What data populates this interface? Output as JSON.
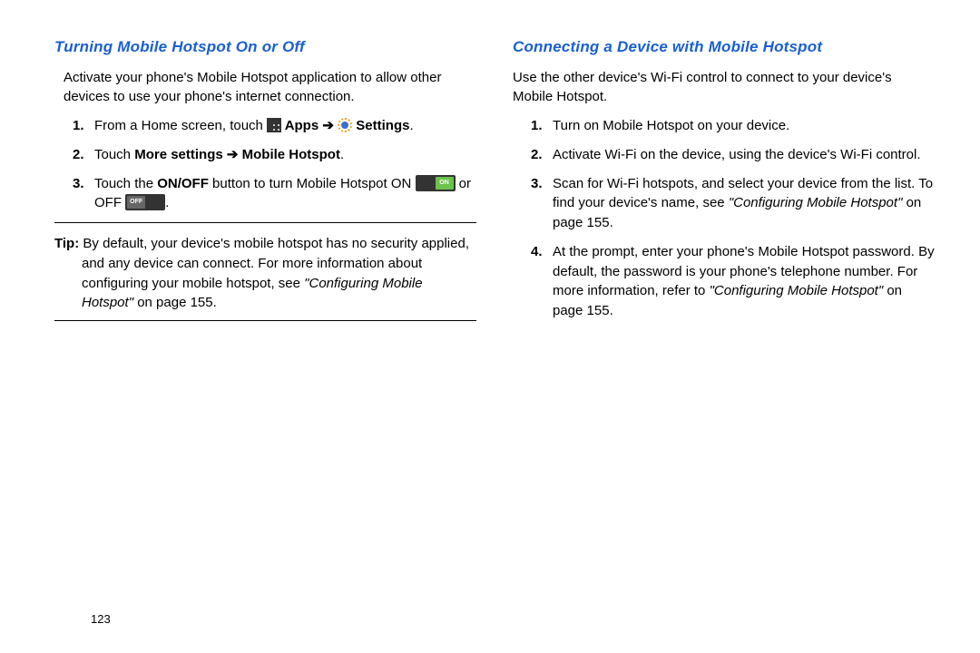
{
  "page_number": "123",
  "left": {
    "heading": "Turning Mobile Hotspot On or Off",
    "intro": "Activate your phone's Mobile Hotspot application to allow other devices to use your phone's internet connection.",
    "step1_pre": "From a Home screen, touch ",
    "apps_label": " Apps ",
    "arrow": "➔",
    "settings_label": " Settings",
    "step1_post": ".",
    "step2_pre": "Touch ",
    "step2_bold": "More settings ➔ Mobile Hotspot",
    "step2_post": ".",
    "step3_pre": "Touch the ",
    "onoff": "ON/OFF",
    "step3_mid": " button to turn Mobile Hotspot ON ",
    "step3_or": " or OFF ",
    "step3_post": ".",
    "tip_label": "Tip: ",
    "tip_body": "By default, your device's mobile hotspot has no security applied, and any device can connect. For more information about configuring your mobile hotspot, see ",
    "tip_ref": "\"Configuring Mobile Hotspot\"",
    "tip_page": " on page 155."
  },
  "right": {
    "heading": "Connecting a Device with Mobile Hotspot",
    "intro": "Use the other device's Wi-Fi control to connect to your device's Mobile Hotspot.",
    "s1": "Turn on Mobile Hotspot on your device.",
    "s2": "Activate Wi-Fi on the device, using the device's Wi-Fi control.",
    "s3a": "Scan for Wi-Fi hotspots, and select your device from the list. To find your device's name, see ",
    "s3ref": "\"Configuring Mobile Hotspot\"",
    "s3b": " on page 155.",
    "s4a": "At the prompt, enter your phone's Mobile Hotspot password. By default, the password is your phone's telephone number. For more information, refer to ",
    "s4ref": "\"Configuring Mobile Hotspot\"",
    "s4b": " on page 155."
  },
  "nums": {
    "n1": "1.",
    "n2": "2.",
    "n3": "3.",
    "n4": "4."
  },
  "toggle": {
    "on": "ON",
    "off": "OFF"
  }
}
